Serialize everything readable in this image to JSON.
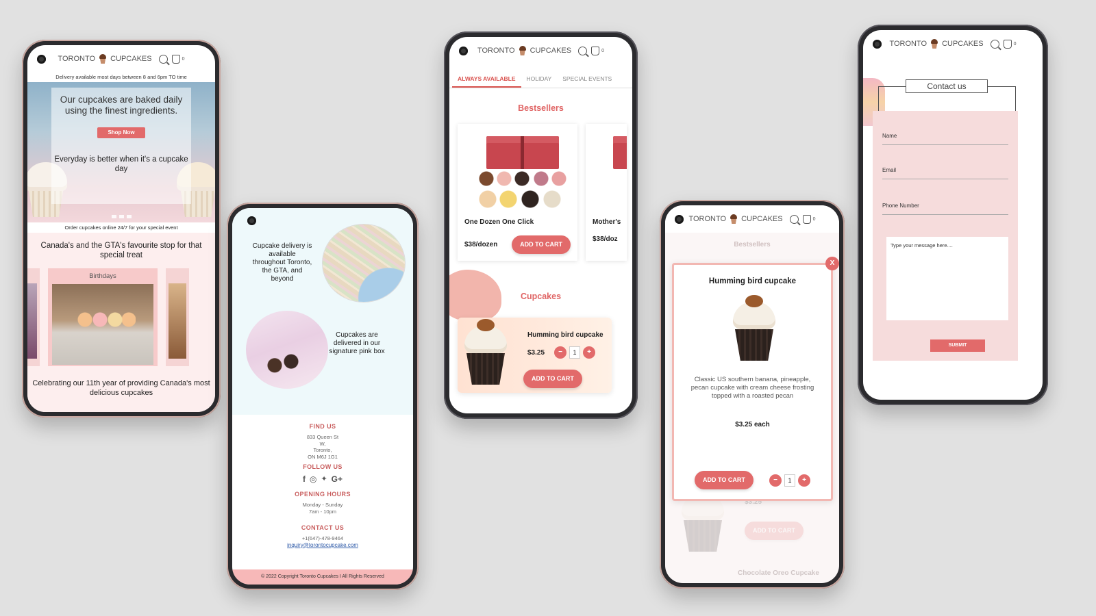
{
  "brand": {
    "left": "TORONTO",
    "right": "CUPCAKES",
    "cart_count": "0"
  },
  "home": {
    "delivery_notice": "Delivery available most days between 8 and 6pm TO time",
    "hero_title": "Our cupcakes are baked daily using the finest ingredients.",
    "shop_button": "Shop Now",
    "hero_subtitle": "Everyday is better when it's a cupcake day",
    "order_notice": "Order cupcakes online 24/7 for your special event",
    "favourite": "Canada's and the GTA's favourite stop for that special treat",
    "slide_label": "Birthdays",
    "celebrate": "Celebrating our 11th year of providing Canada's most delicious cupcakes"
  },
  "about": {
    "delivery_text": "Cupcake delivery is available throughout Toronto, the GTA, and beyond",
    "box_text": "Cupcakes are delivered in our signature pink box",
    "find_us": "FIND US",
    "address": [
      "833 Queen St",
      "W,",
      "Toronto,",
      "ON M6J 1G1"
    ],
    "follow_us": "FOLLOW US",
    "socials": [
      "f",
      "◎",
      "🐦",
      "G+"
    ],
    "hours_title": "OPENING HOURS",
    "hours": [
      "Monday - Sunday",
      "7am - 10pm"
    ],
    "contact_title": "CONTACT US",
    "phone": "+1(647)-478-9464",
    "email": "inquiry@torontocupcake.com",
    "copyright": "© 2022 Copyright Toronto Cupcakes I  All Rights Reserved"
  },
  "shop": {
    "tabs": [
      "ALWAYS AVAILABLE",
      "HOLIDAY",
      "SPECIAL EVENTS"
    ],
    "bestsellers_title": "Bestsellers",
    "product1": {
      "name": "One Dozen One Click",
      "price": "$38/dozen",
      "button": "ADD TO CART"
    },
    "product2": {
      "name": "Mother's",
      "price": "$38/doz"
    },
    "cupcakes_title": "Cupcakes",
    "cupcake": {
      "name": "Humming bird cupcake",
      "price": "$3.25",
      "qty": "1",
      "button": "ADD TO CART"
    }
  },
  "detail": {
    "bg_title": "Bestsellers",
    "close": "X",
    "title": "Humming bird cupcake",
    "description": "Classic US southern banana, pineapple, pecan cupcake with cream cheese frosting topped with a roasted pecan",
    "price": "$3.25 each",
    "button": "ADD TO CART",
    "qty": "1",
    "bg_price": "$3.25",
    "bg_button": "ADD TO CART",
    "bg_next": "Chocolate Oreo Cupcake"
  },
  "contact": {
    "title": "Contact us",
    "name": "Name",
    "email": "Email",
    "phone": "Phone Number",
    "message_placeholder": "Type your message here....",
    "submit": "SUBMIT"
  },
  "colors": {
    "accent": "#e26a6a",
    "title_red": "#e06565",
    "pink_bg": "#fdeeee"
  }
}
